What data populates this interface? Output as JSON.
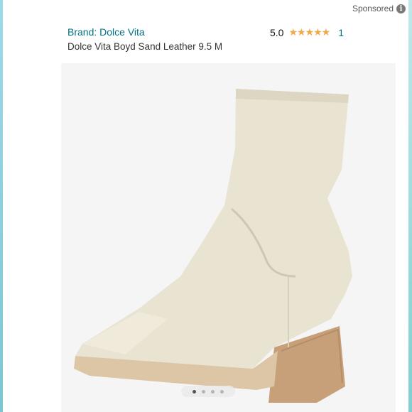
{
  "ad": {
    "sponsored_label": "Sponsored",
    "info_icon": "i"
  },
  "product": {
    "brand": "Brand: Dolce Vita",
    "title": "Dolce Vita Boyd Sand Leather 9.5 M",
    "rating": "5.0",
    "stars": "★★★★★",
    "review_count": "1"
  },
  "carousel": {
    "total": 4,
    "active": 1
  },
  "colors": {
    "link": "#007185",
    "star": "#f3a847",
    "bg": "#8fd3da"
  }
}
